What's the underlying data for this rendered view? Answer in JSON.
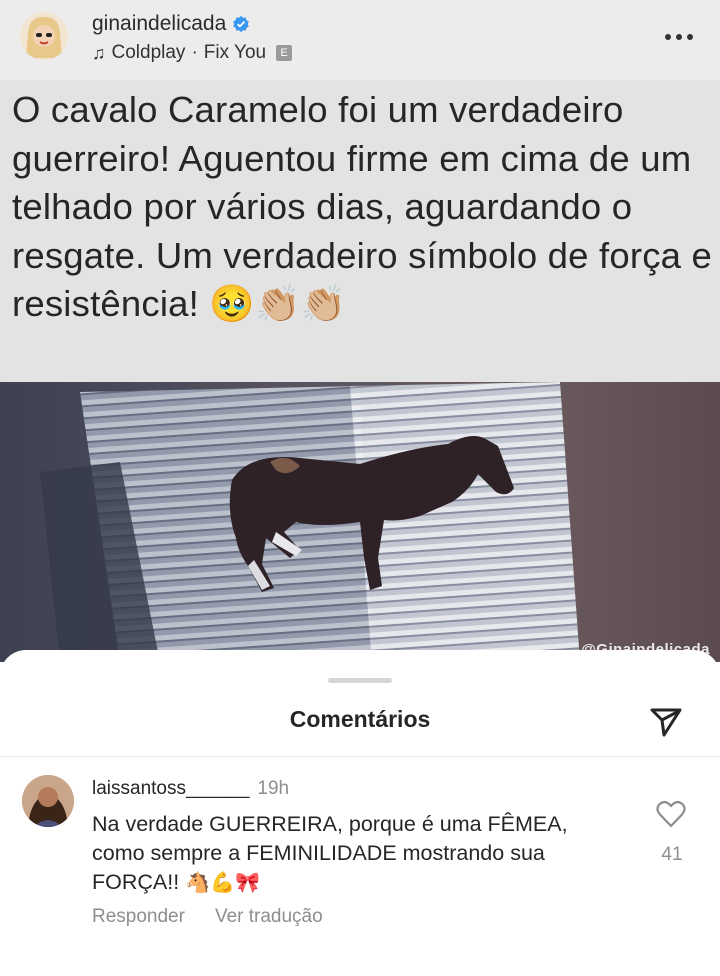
{
  "post": {
    "username": "ginaindelicada",
    "music_artist": "Coldplay",
    "music_separator": "·",
    "music_track": "Fix You",
    "explicit_badge": "E",
    "more_icon": "more-horizontal-icon",
    "caption": "O cavalo Caramelo foi um verdadeiro guerreiro! Aguentou firme em cima de um telhado por vários dias, aguardando o resgate. Um verdadeiro símbolo de força e resistência! 🥹👏🏼👏🏼",
    "watermark": "@Ginaindelicada",
    "accent_verified": "#3897f0"
  },
  "comments_sheet": {
    "title": "Comentários",
    "share_icon": "paper-plane-icon",
    "comment": {
      "username": "laissantoss______",
      "time": "19h",
      "text_line1": "Na verdade GUERREIRA, porque é uma FÊMEA,",
      "text_line2": "como sempre  a FEMINILIDADE mostrando sua",
      "text_line3": "FORÇA!!",
      "emojis": "🐴💪🎀",
      "likes": "41",
      "reply_label": "Responder",
      "translate_label": "Ver tradução"
    }
  }
}
